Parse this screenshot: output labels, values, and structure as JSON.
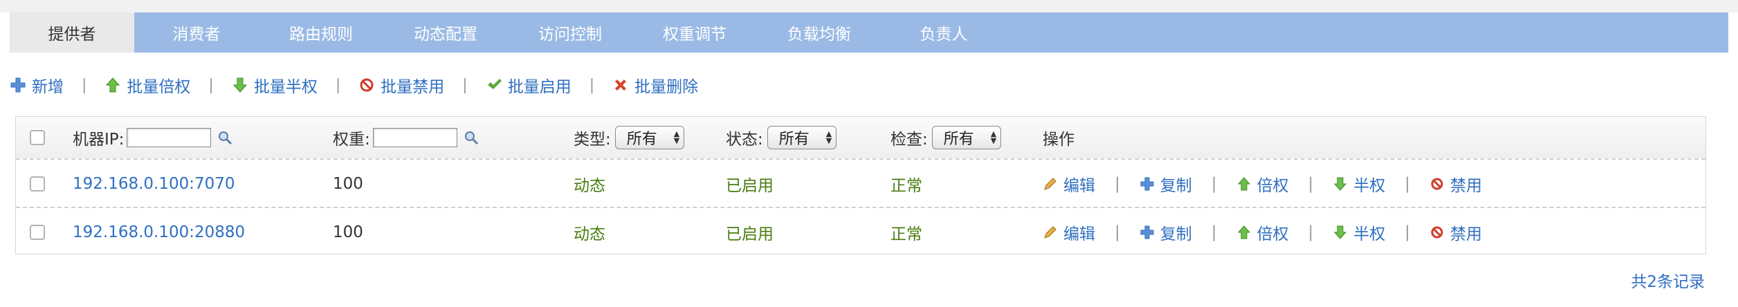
{
  "tabs": [
    {
      "label": "提供者"
    },
    {
      "label": "消费者"
    },
    {
      "label": "路由规则"
    },
    {
      "label": "动态配置"
    },
    {
      "label": "访问控制"
    },
    {
      "label": "权重调节"
    },
    {
      "label": "负载均衡"
    },
    {
      "label": "负责人"
    }
  ],
  "toolbar": {
    "add": "新增",
    "batch_double": "批量倍权",
    "batch_half": "批量半权",
    "batch_disable": "批量禁用",
    "batch_enable": "批量启用",
    "batch_delete": "批量删除",
    "separator": "|"
  },
  "table": {
    "headers": {
      "ip": "机器IP:",
      "weight": "权重:",
      "type": "类型:",
      "status": "状态:",
      "check": "检查:",
      "actions": "操作"
    },
    "filters": {
      "ip_value": "",
      "weight_value": "",
      "type_selected": "所有",
      "status_selected": "所有",
      "check_selected": "所有"
    },
    "rows": [
      {
        "ip": "192.168.0.100:7070",
        "weight": "100",
        "type": "动态",
        "status": "已启用",
        "check": "正常"
      },
      {
        "ip": "192.168.0.100:20880",
        "weight": "100",
        "type": "动态",
        "status": "已启用",
        "check": "正常"
      }
    ],
    "actions": {
      "edit": "编辑",
      "copy": "复制",
      "double": "倍权",
      "half": "半权",
      "disable": "禁用"
    }
  },
  "footer": {
    "total": "共2条记录"
  },
  "colors": {
    "tabbar": "#9abae5",
    "active_tab": "#e9e9e9",
    "link": "#2f6fc1",
    "status_green": "#4a7d10"
  }
}
